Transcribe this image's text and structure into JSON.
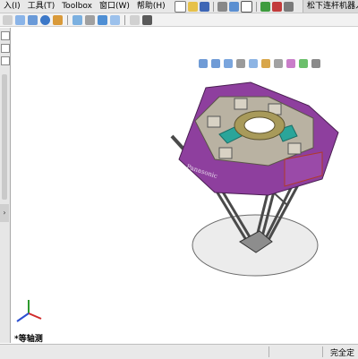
{
  "menu": {
    "items": [
      "入(I)",
      "工具(T)",
      "Toolbox",
      "窗口(W)",
      "帮助(H)"
    ]
  },
  "document": {
    "title": "松下连杆机器人"
  },
  "view": {
    "name": "*等轴测"
  },
  "model": {
    "brand_text": "Panasonic"
  },
  "status": {
    "text": "完全定"
  },
  "colors": {
    "accent_purple": "#8e3f9e",
    "body_grey": "#b9b2a2",
    "teal": "#2aa59a",
    "brass": "#a89a5a"
  },
  "toolbar": {
    "icons": [
      "new-icon",
      "open-icon",
      "save-icon",
      "print-icon",
      "undo-icon",
      "select-icon",
      "rebuild-icon",
      "options-icon"
    ]
  },
  "view_toolbar": {
    "icons": [
      "zoom-fit-icon",
      "zoom-area-icon",
      "previous-view-icon",
      "section-view-icon",
      "view-orientation-icon",
      "display-style-icon",
      "hide-show-icon",
      "appearance-icon",
      "scene-icon",
      "display-settings-icon"
    ]
  }
}
